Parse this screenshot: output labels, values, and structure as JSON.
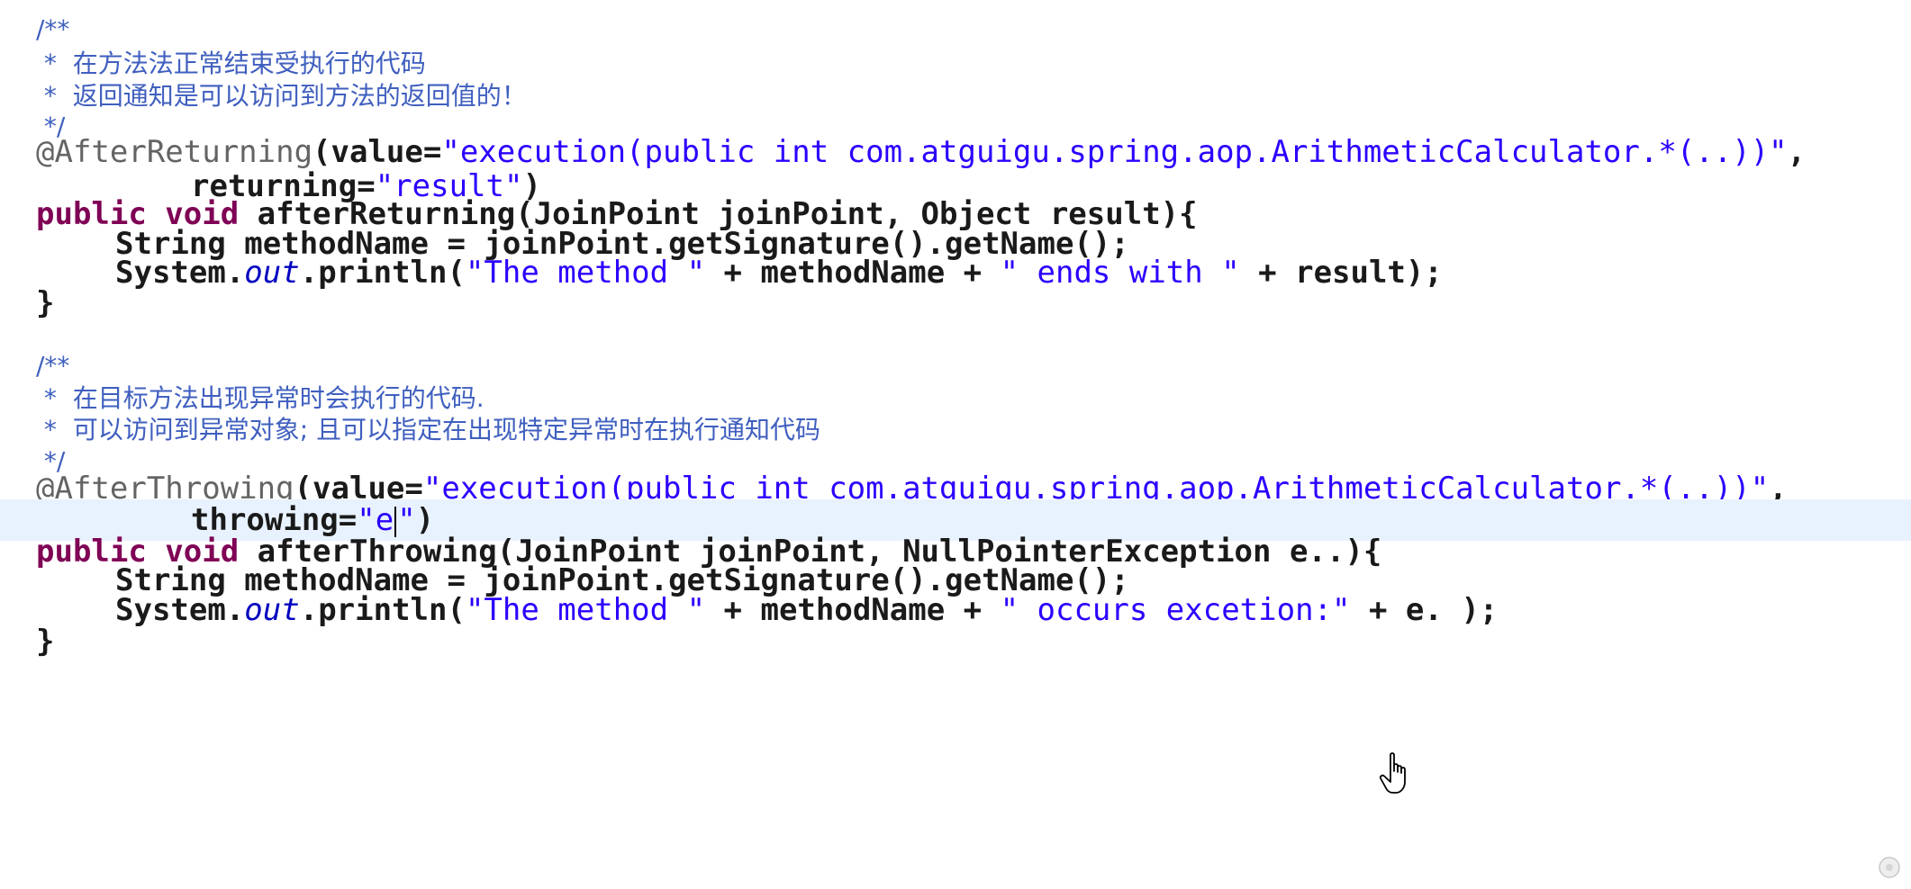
{
  "editor": {
    "lines": [
      {
        "id": "l0",
        "cls": "comment-line ind1",
        "tokens": [
          {
            "t": "/**",
            "c": "comment"
          }
        ]
      },
      {
        "id": "l1",
        "cls": "comment-line ind1",
        "tokens": [
          {
            "t": " *  在方法法正常结束受执行的代码",
            "c": "comment"
          }
        ]
      },
      {
        "id": "l2",
        "cls": "comment-line ind1",
        "tokens": [
          {
            "t": " *  返回通知是可以访问到方法的返回值的！",
            "c": "comment"
          }
        ]
      },
      {
        "id": "l3",
        "cls": "comment-line ind1",
        "tokens": [
          {
            "t": " */",
            "c": "comment"
          }
        ]
      },
      {
        "id": "l4",
        "cls": "ind1",
        "tokens": [
          {
            "t": "@AfterReturning",
            "c": "annotation"
          },
          {
            "t": "(value=",
            "c": "plain"
          },
          {
            "t": "\"execution(public int com.atguigu.spring.aop.ArithmeticCalculator.*(..))\"",
            "c": "string"
          },
          {
            "t": ",",
            "c": "plain"
          }
        ]
      },
      {
        "id": "l5",
        "cls": "ind3",
        "tokens": [
          {
            "t": "returning=",
            "c": "plain"
          },
          {
            "t": "\"result\"",
            "c": "string"
          },
          {
            "t": ")",
            "c": "plain"
          }
        ]
      },
      {
        "id": "l6",
        "cls": "ind1",
        "tokens": [
          {
            "t": "public void",
            "c": "keyword"
          },
          {
            "t": " afterReturning(JoinPoint joinPoint, Object result){",
            "c": "plain"
          }
        ]
      },
      {
        "id": "l7",
        "cls": "ind2",
        "tokens": [
          {
            "t": "String methodName = joinPoint.getSignature().getName();",
            "c": "plain"
          }
        ]
      },
      {
        "id": "l8",
        "cls": "ind2",
        "tokens": [
          {
            "t": "System.",
            "c": "plain"
          },
          {
            "t": "out",
            "c": "static"
          },
          {
            "t": ".println(",
            "c": "plain"
          },
          {
            "t": "\"The method \"",
            "c": "string"
          },
          {
            "t": " + methodName + ",
            "c": "plain"
          },
          {
            "t": "\" ends with \"",
            "c": "string"
          },
          {
            "t": " + result);",
            "c": "plain"
          }
        ]
      },
      {
        "id": "l9",
        "cls": "ind1",
        "tokens": [
          {
            "t": "}",
            "c": "plain"
          }
        ]
      },
      {
        "id": "l10",
        "cls": "ind1",
        "tokens": []
      },
      {
        "id": "l11",
        "cls": "comment-line ind1",
        "tokens": [
          {
            "t": "/**",
            "c": "comment"
          }
        ]
      },
      {
        "id": "l12",
        "cls": "comment-line ind1",
        "tokens": [
          {
            "t": " *  在目标方法出现异常时会执行的代码.",
            "c": "comment"
          }
        ]
      },
      {
        "id": "l13",
        "cls": "comment-line ind1",
        "tokens": [
          {
            "t": " *  可以访问到异常对象; 且可以指定在出现特定异常时在执行通知代码",
            "c": "comment"
          }
        ]
      },
      {
        "id": "l14",
        "cls": "comment-line ind1",
        "tokens": [
          {
            "t": " */",
            "c": "comment"
          }
        ]
      },
      {
        "id": "l15",
        "cls": "ind1",
        "tokens": [
          {
            "t": "@AfterThrowing",
            "c": "annotation"
          },
          {
            "t": "(value=",
            "c": "plain"
          },
          {
            "t": "\"execution(public int com.atguigu.spring.aop.ArithmeticCalculator.*(..))\"",
            "c": "string"
          },
          {
            "t": ",",
            "c": "plain"
          }
        ]
      },
      {
        "id": "l16",
        "cls": "ind3 current",
        "tokens": [
          {
            "t": "throwing=",
            "c": "plain"
          },
          {
            "t": "\"e",
            "c": "string"
          },
          {
            "t": "",
            "c": "caret"
          },
          {
            "t": "\"",
            "c": "string"
          },
          {
            "t": ")",
            "c": "plain"
          }
        ]
      },
      {
        "id": "l17",
        "cls": "ind1",
        "tokens": [
          {
            "t": "public void",
            "c": "keyword"
          },
          {
            "t": " afterThrowing(JoinPoint joinPoint, NullPointerException e..){",
            "c": "plain"
          }
        ]
      },
      {
        "id": "l18",
        "cls": "ind2",
        "tokens": [
          {
            "t": "String methodName = joinPoint.getSignature().getName();",
            "c": "plain"
          }
        ]
      },
      {
        "id": "l19",
        "cls": "ind2",
        "tokens": [
          {
            "t": "System.",
            "c": "plain"
          },
          {
            "t": "out",
            "c": "static"
          },
          {
            "t": ".println(",
            "c": "plain"
          },
          {
            "t": "\"The method \"",
            "c": "string"
          },
          {
            "t": " + methodName + ",
            "c": "plain"
          },
          {
            "t": "\" occurs excetion:\"",
            "c": "string"
          },
          {
            "t": " + e. );",
            "c": "plain"
          }
        ]
      },
      {
        "id": "l20",
        "cls": "ind1",
        "tokens": [
          {
            "t": "}",
            "c": "plain"
          }
        ]
      }
    ]
  },
  "colors": {
    "comment": "#3f5fbf",
    "annotation": "#646464",
    "keyword": "#7f0055",
    "string": "#2a00ff",
    "static_field": "#0000c0",
    "current_line": "#e8f2fe"
  },
  "icons": {
    "mouse_cursor": "hand-pointer-icon",
    "corner_mark": "corner-mark-icon"
  }
}
